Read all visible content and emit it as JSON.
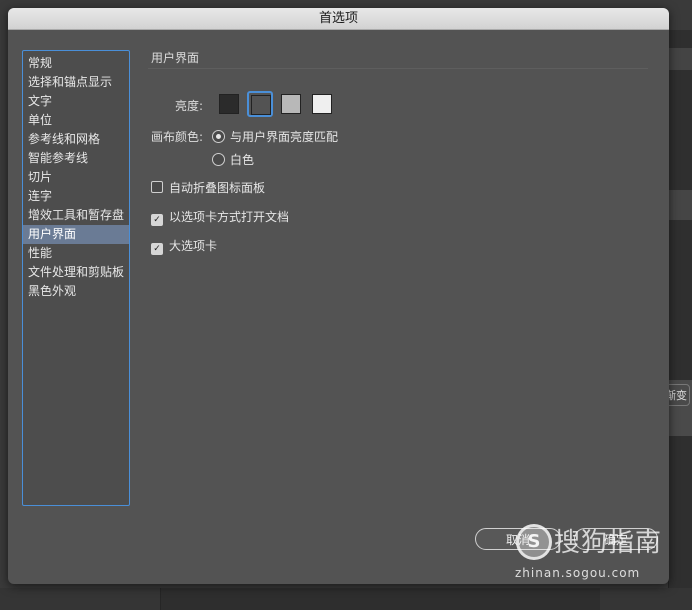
{
  "dialog": {
    "title": "首选项"
  },
  "sidebar": {
    "items": [
      {
        "label": "常规",
        "selected": false
      },
      {
        "label": "选择和锚点显示",
        "selected": false
      },
      {
        "label": "文字",
        "selected": false
      },
      {
        "label": "单位",
        "selected": false
      },
      {
        "label": "参考线和网格",
        "selected": false
      },
      {
        "label": "智能参考线",
        "selected": false
      },
      {
        "label": "切片",
        "selected": false
      },
      {
        "label": "连字",
        "selected": false
      },
      {
        "label": "增效工具和暂存盘",
        "selected": false
      },
      {
        "label": "用户界面",
        "selected": true
      },
      {
        "label": "性能",
        "selected": false
      },
      {
        "label": "文件处理和剪贴板",
        "selected": false
      },
      {
        "label": "黑色外观",
        "selected": false
      }
    ]
  },
  "main": {
    "section_title": "用户界面",
    "brightness": {
      "label": "亮度:",
      "swatches": [
        {
          "color": "#2b2b2b",
          "selected": false
        },
        {
          "color": "#535353",
          "selected": true
        },
        {
          "color": "#b8b8b8",
          "selected": false
        },
        {
          "color": "#efefef",
          "selected": false
        }
      ]
    },
    "canvas_color": {
      "label": "画布颜色:",
      "options": [
        {
          "label": "与用户界面亮度匹配",
          "checked": true
        },
        {
          "label": "白色",
          "checked": false
        }
      ]
    },
    "checkboxes": [
      {
        "label": "自动折叠图标面板",
        "checked": false
      },
      {
        "label": "以选项卡方式打开文档",
        "checked": true
      },
      {
        "label": "大选项卡",
        "checked": true
      }
    ]
  },
  "buttons": {
    "cancel": "取消",
    "ok": "确定"
  },
  "background": {
    "partial_button_label": "渐变"
  },
  "watermark": {
    "brand": "搜狗指南",
    "url": "zhinan.sogou.com",
    "logo_letter": "S"
  }
}
